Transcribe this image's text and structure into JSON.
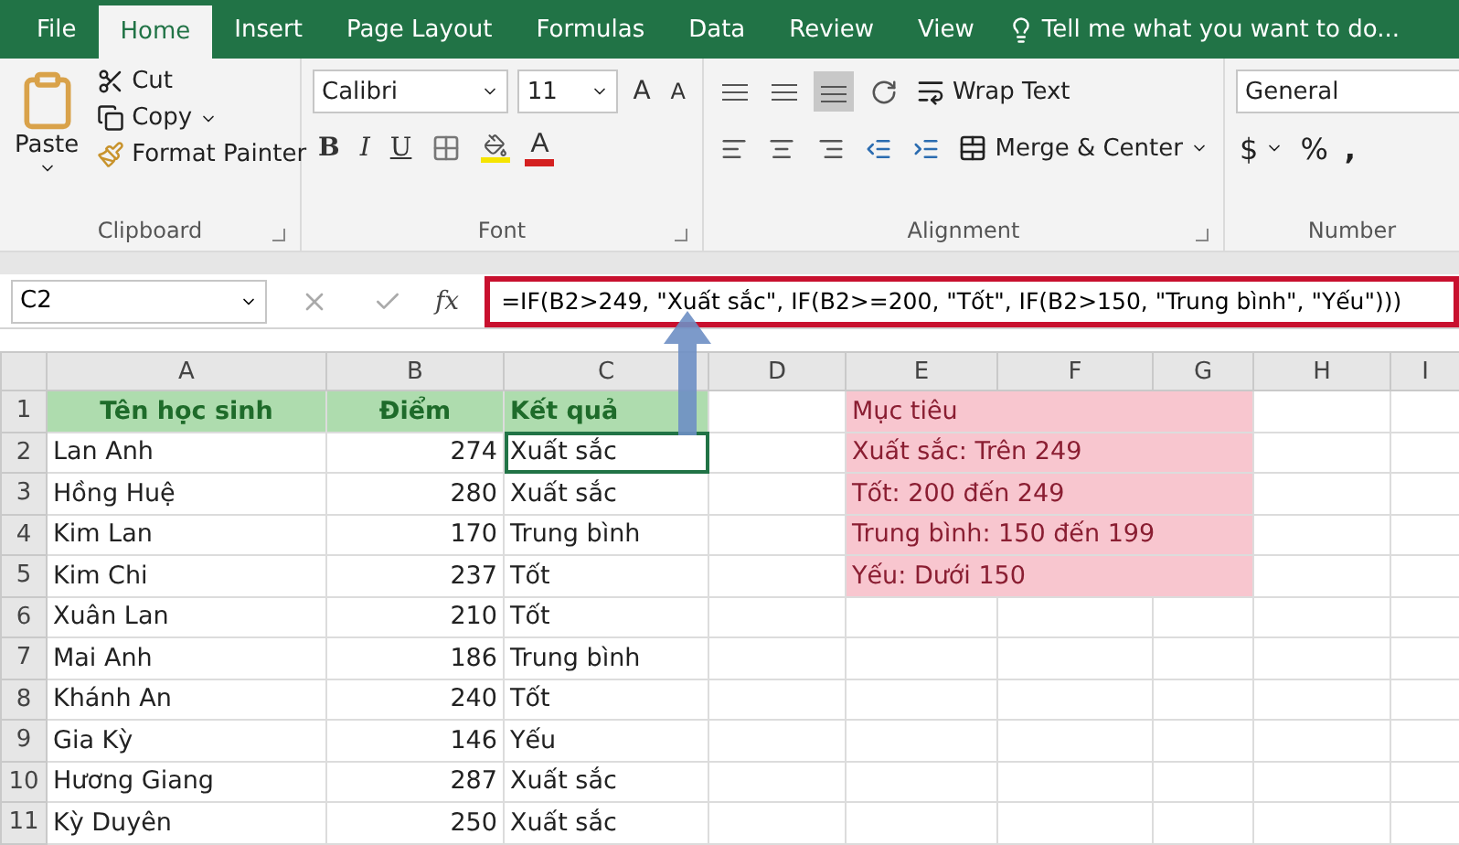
{
  "tabs": [
    {
      "label": "File",
      "selected": false
    },
    {
      "label": "Home",
      "selected": true
    },
    {
      "label": "Insert",
      "selected": false
    },
    {
      "label": "Page Layout",
      "selected": false
    },
    {
      "label": "Formulas",
      "selected": false
    },
    {
      "label": "Data",
      "selected": false
    },
    {
      "label": "Review",
      "selected": false
    },
    {
      "label": "View",
      "selected": false
    }
  ],
  "tell_me": "Tell me what you want to do...",
  "clipboard": {
    "paste": "Paste",
    "cut": "Cut",
    "copy": "Copy",
    "format_painter": "Format Painter",
    "label": "Clipboard"
  },
  "font": {
    "name": "Calibri",
    "size": "11",
    "grow": "A",
    "shrink": "A",
    "bold": "B",
    "italic": "I",
    "underline": "U",
    "font_color": "A",
    "label": "Font"
  },
  "alignment": {
    "valign_buttons": [
      {
        "kind": "top",
        "selected": false
      },
      {
        "kind": "middle",
        "selected": false
      },
      {
        "kind": "bottom",
        "selected": true
      }
    ],
    "wrap": "Wrap Text",
    "merge": "Merge & Center",
    "label": "Alignment"
  },
  "number": {
    "format": "General",
    "currency": "$",
    "percent": "%",
    "comma": ",",
    "label": "Number"
  },
  "formula_bar": {
    "name_box": "C2",
    "fx": "fx",
    "formula": "=IF(B2>249, \"Xuất sắc\", IF(B2>=200, \"Tốt\", IF(B2>150, \"Trung bình\", \"Yếu\")))"
  },
  "columns": [
    "A",
    "B",
    "C",
    "D",
    "E",
    "F",
    "G",
    "H",
    "I"
  ],
  "rows": [
    {
      "number": "1",
      "kind": "header",
      "name": "Tên học sinh",
      "score": "Điểm",
      "result": "Kết quả",
      "note": "Mục tiêu",
      "selected": false
    },
    {
      "number": "2",
      "kind": "data",
      "name": "Lan Anh",
      "score": "274",
      "result": "Xuất sắc",
      "note": "Xuất sắc: Trên 249",
      "selected": true
    },
    {
      "number": "3",
      "kind": "data",
      "name": "Hồng Huệ",
      "score": "280",
      "result": "Xuất sắc",
      "note": "Tốt: 200 đến 249",
      "selected": false
    },
    {
      "number": "4",
      "kind": "data",
      "name": "Kim Lan",
      "score": "170",
      "result": "Trung bình",
      "note": "Trung bình: 150 đến 199",
      "selected": false
    },
    {
      "number": "5",
      "kind": "data",
      "name": "Kim Chi",
      "score": "237",
      "result": "Tốt",
      "note": "Yếu: Dưới 150",
      "selected": false
    },
    {
      "number": "6",
      "kind": "data",
      "name": "Xuân Lan",
      "score": "210",
      "result": "Tốt",
      "selected": false
    },
    {
      "number": "7",
      "kind": "data",
      "name": "Mai Anh",
      "score": "186",
      "result": "Trung bình",
      "selected": false
    },
    {
      "number": "8",
      "kind": "data",
      "name": "Khánh An",
      "score": "240",
      "result": "Tốt",
      "selected": false
    },
    {
      "number": "9",
      "kind": "data",
      "name": "Gia Kỳ",
      "score": "146",
      "result": "Yếu",
      "selected": false
    },
    {
      "number": "10",
      "kind": "data",
      "name": "Hương Giang",
      "score": "287",
      "result": "Xuất sắc",
      "selected": false
    },
    {
      "number": "11",
      "kind": "data",
      "name": "Kỳ Duyên",
      "score": "250",
      "result": "Xuất sắc",
      "selected": false
    }
  ]
}
